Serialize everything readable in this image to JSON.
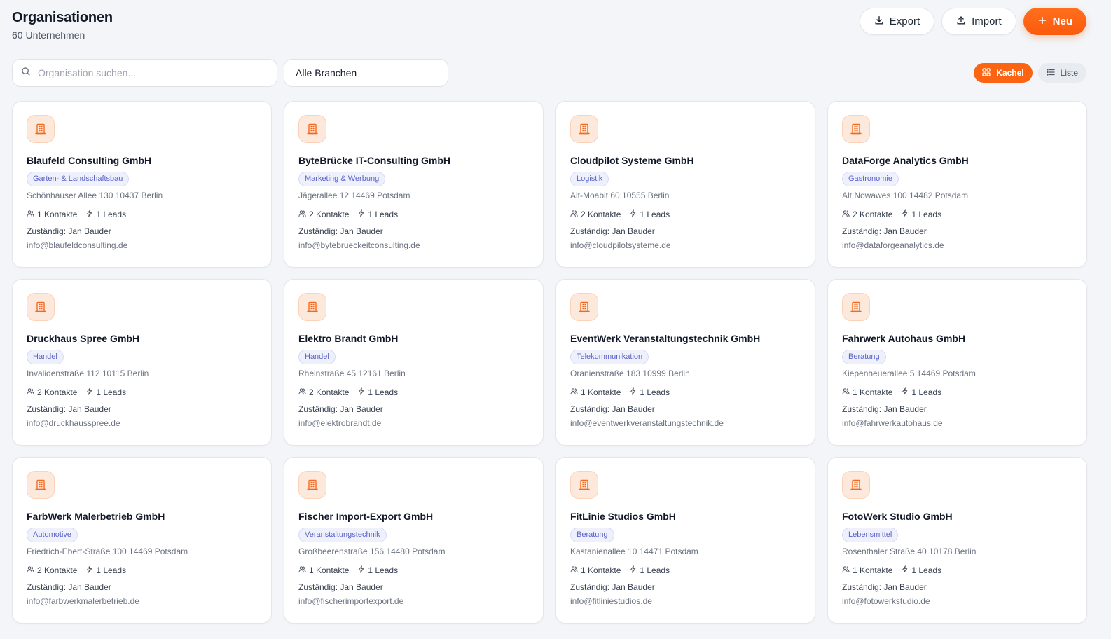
{
  "header": {
    "title": "Organisationen",
    "subtitle": "60 Unternehmen"
  },
  "actions": {
    "export_label": "Export",
    "import_label": "Import",
    "new_label": "Neu"
  },
  "filters": {
    "search_placeholder": "Organisation suchen...",
    "branch_selected": "Alle Branchen"
  },
  "view_toggle": {
    "tiles_label": "Kachel",
    "list_label": "Liste",
    "active": "tiles"
  },
  "colors": {
    "accent": "#fc6411",
    "tag_text": "#5b63c9",
    "tag_bg": "#eef0fc"
  },
  "organizations": [
    {
      "name": "Blaufeld Consulting GmbH",
      "industry": "Garten- & Landschaftsbau",
      "address": "Schönhauser Allee 130 10437 Berlin",
      "contacts": "1 Kontakte",
      "leads": "1 Leads",
      "owner": "Zuständig: Jan Bauder",
      "email": "info@blaufeldconsulting.de"
    },
    {
      "name": "ByteBrücke IT-Consulting GmbH",
      "industry": "Marketing & Werbung",
      "address": "Jägerallee 12 14469 Potsdam",
      "contacts": "2 Kontakte",
      "leads": "1 Leads",
      "owner": "Zuständig: Jan Bauder",
      "email": "info@bytebrueckeitconsulting.de"
    },
    {
      "name": "Cloudpilot Systeme GmbH",
      "industry": "Logistik",
      "address": "Alt-Moabit 60 10555 Berlin",
      "contacts": "2 Kontakte",
      "leads": "1 Leads",
      "owner": "Zuständig: Jan Bauder",
      "email": "info@cloudpilotsysteme.de"
    },
    {
      "name": "DataForge Analytics GmbH",
      "industry": "Gastronomie",
      "address": "Alt Nowawes 100 14482 Potsdam",
      "contacts": "2 Kontakte",
      "leads": "1 Leads",
      "owner": "Zuständig: Jan Bauder",
      "email": "info@dataforgeanalytics.de"
    },
    {
      "name": "Druckhaus Spree GmbH",
      "industry": "Handel",
      "address": "Invalidenstraße 112 10115 Berlin",
      "contacts": "2 Kontakte",
      "leads": "1 Leads",
      "owner": "Zuständig: Jan Bauder",
      "email": "info@druckhausspree.de"
    },
    {
      "name": "Elektro Brandt GmbH",
      "industry": "Handel",
      "address": "Rheinstraße 45 12161 Berlin",
      "contacts": "2 Kontakte",
      "leads": "1 Leads",
      "owner": "Zuständig: Jan Bauder",
      "email": "info@elektrobrandt.de"
    },
    {
      "name": "EventWerk Veranstaltungstechnik GmbH",
      "industry": "Telekommunikation",
      "address": "Oranienstraße 183 10999 Berlin",
      "contacts": "1 Kontakte",
      "leads": "1 Leads",
      "owner": "Zuständig: Jan Bauder",
      "email": "info@eventwerkveranstaltungstechnik.de"
    },
    {
      "name": "Fahrwerk Autohaus GmbH",
      "industry": "Beratung",
      "address": "Kiepenheuerallee 5 14469 Potsdam",
      "contacts": "1 Kontakte",
      "leads": "1 Leads",
      "owner": "Zuständig: Jan Bauder",
      "email": "info@fahrwerkautohaus.de"
    },
    {
      "name": "FarbWerk Malerbetrieb GmbH",
      "industry": "Automotive",
      "address": "Friedrich-Ebert-Straße 100 14469 Potsdam",
      "contacts": "2 Kontakte",
      "leads": "1 Leads",
      "owner": "Zuständig: Jan Bauder",
      "email": "info@farbwerkmalerbetrieb.de"
    },
    {
      "name": "Fischer Import-Export GmbH",
      "industry": "Veranstaltungstechnik",
      "address": "Großbeerenstraße 156 14480 Potsdam",
      "contacts": "1 Kontakte",
      "leads": "1 Leads",
      "owner": "Zuständig: Jan Bauder",
      "email": "info@fischerimportexport.de"
    },
    {
      "name": "FitLinie Studios GmbH",
      "industry": "Beratung",
      "address": "Kastanienallee 10 14471 Potsdam",
      "contacts": "1 Kontakte",
      "leads": "1 Leads",
      "owner": "Zuständig: Jan Bauder",
      "email": "info@fitliniestudios.de"
    },
    {
      "name": "FotoWerk Studio GmbH",
      "industry": "Lebensmittel",
      "address": "Rosenthaler Straße 40 10178 Berlin",
      "contacts": "1 Kontakte",
      "leads": "1 Leads",
      "owner": "Zuständig: Jan Bauder",
      "email": "info@fotowerkstudio.de"
    }
  ]
}
